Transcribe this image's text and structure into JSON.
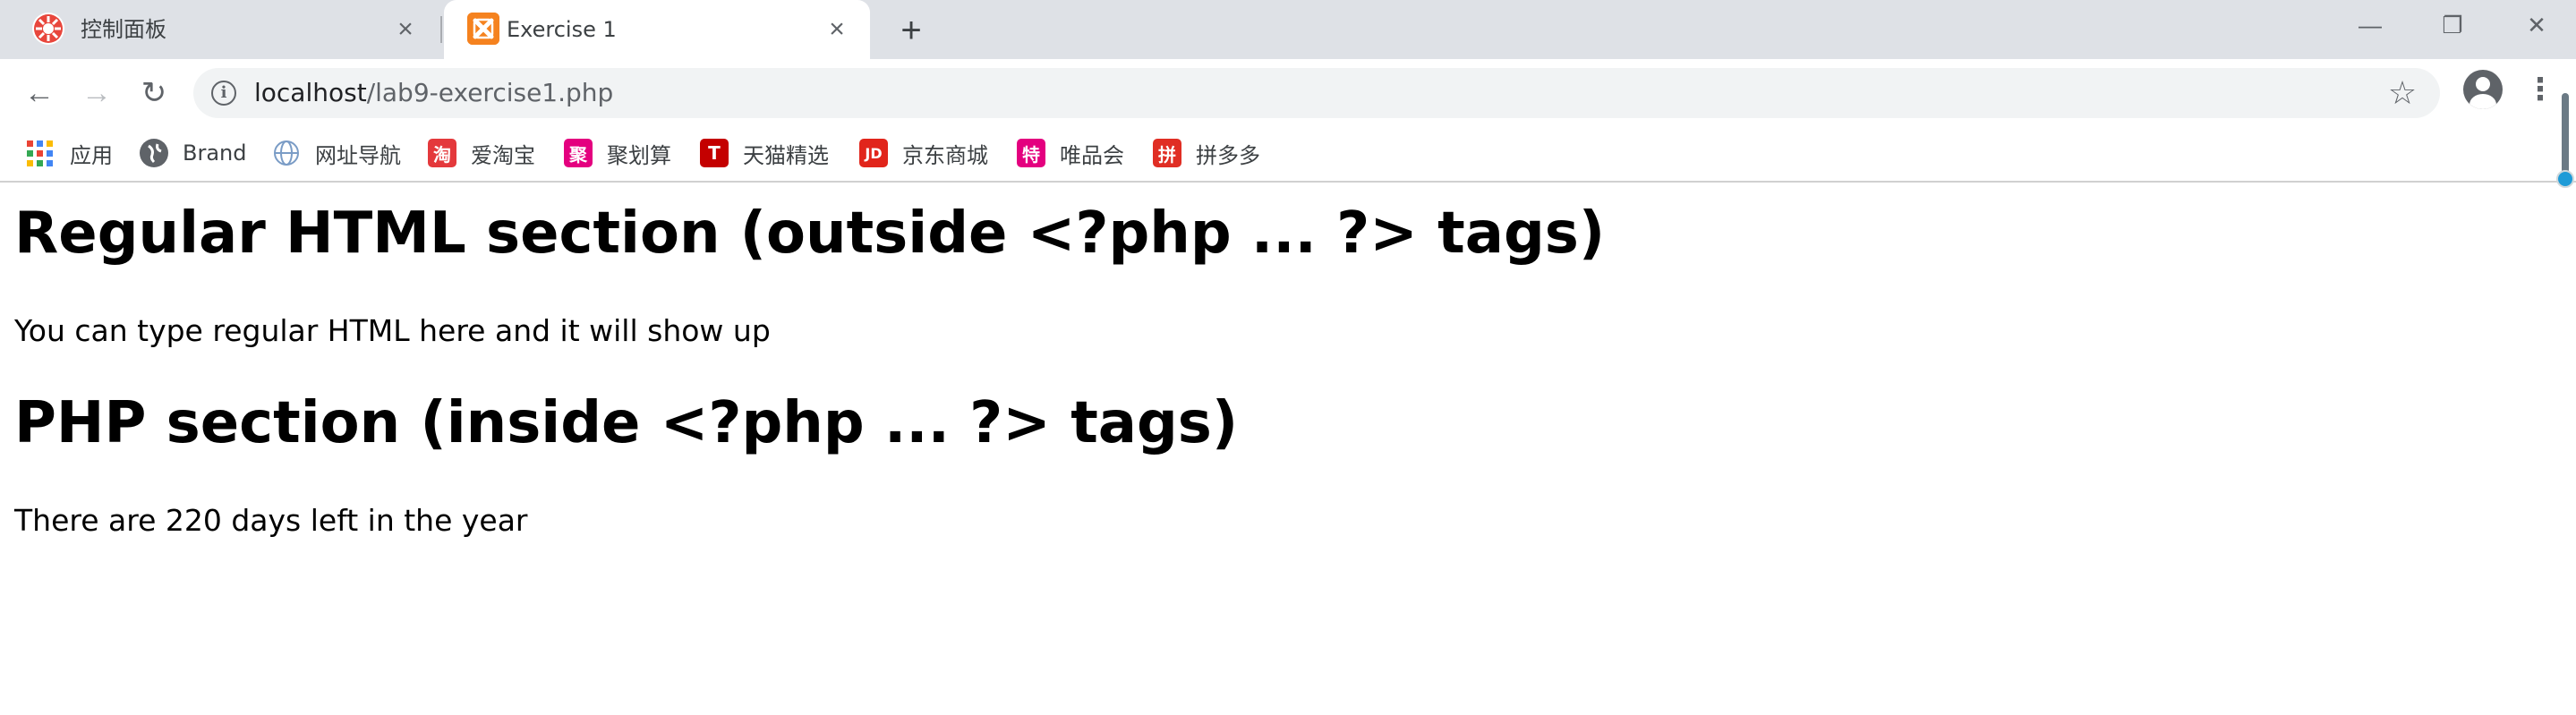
{
  "tabs": [
    {
      "title": "控制面板",
      "icon": "xampp-control-icon",
      "active": false
    },
    {
      "title": "Exercise 1",
      "icon": "xampp-icon",
      "active": true
    }
  ],
  "window_controls": {
    "minimize": "—",
    "restore": "❐",
    "close": "✕"
  },
  "toolbar": {
    "back": "←",
    "forward": "→",
    "reload": "↻",
    "info_icon": "i",
    "url_host": "localhost",
    "url_path": "/lab9-exercise1.php",
    "star": "☆",
    "menu": "⋮"
  },
  "bookmarks": [
    {
      "label": "应用",
      "icon": "apps-grid-icon"
    },
    {
      "label": "Brand",
      "icon": "globe-dark-icon"
    },
    {
      "label": "网址导航",
      "icon": "globe-icon"
    },
    {
      "label": "爱淘宝",
      "icon": "taobao-icon",
      "glyph": "淘",
      "color": "#e4393c"
    },
    {
      "label": "聚划算",
      "icon": "juhuasuan-icon",
      "glyph": "聚",
      "color": "#e4007f"
    },
    {
      "label": "天猫精选",
      "icon": "tmall-icon",
      "glyph": "T",
      "color": "#c40000"
    },
    {
      "label": "京东商城",
      "icon": "jd-icon",
      "glyph": "JD",
      "color": "#e1251b"
    },
    {
      "label": "唯品会",
      "icon": "vip-icon",
      "glyph": "特",
      "color": "#e4007f"
    },
    {
      "label": "拼多多",
      "icon": "pinduoduo-icon",
      "glyph": "拼",
      "color": "#e02e24"
    }
  ],
  "page": {
    "heading1": "Regular HTML section (outside <?php ... ?> tags)",
    "paragraph1": "You can type regular HTML here and it will show up",
    "heading2": "PHP section (inside <?php ... ?> tags)",
    "paragraph2": "There are 220 days left in the year"
  }
}
